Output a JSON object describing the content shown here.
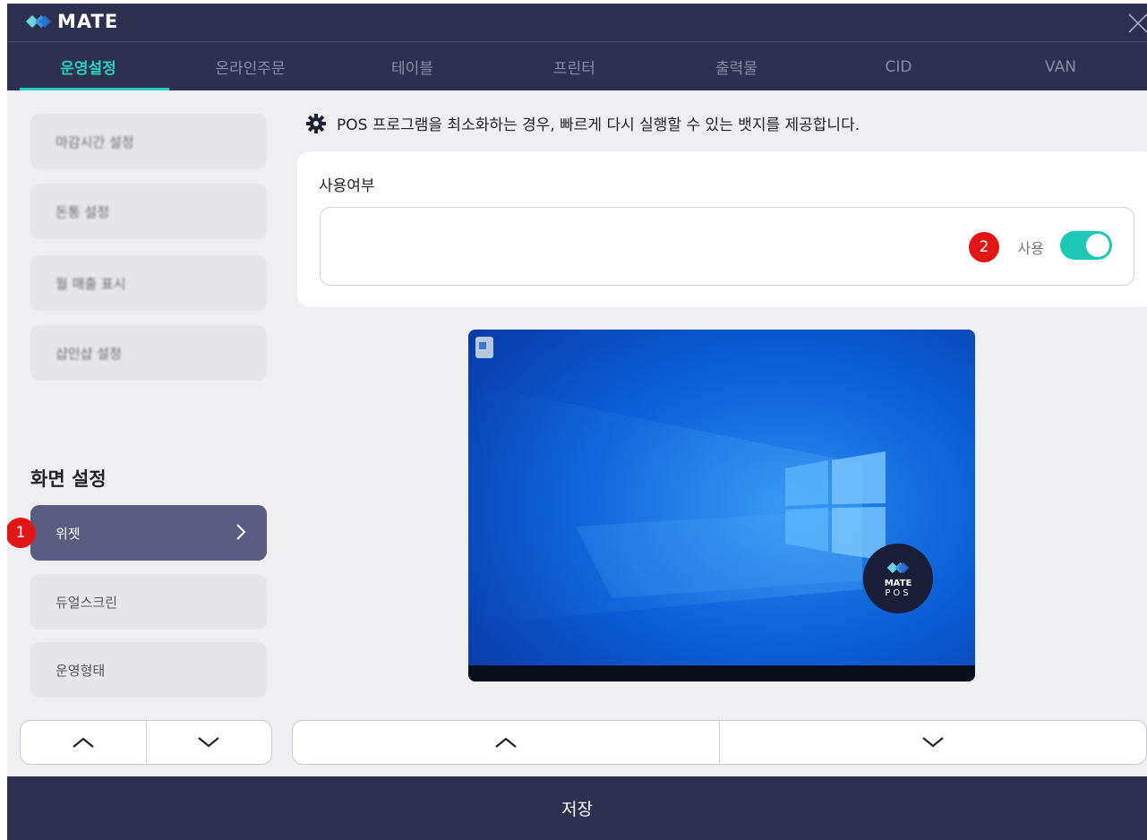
{
  "app": {
    "logo_text": "MATE"
  },
  "tabs": [
    {
      "label": "운영설정",
      "active": true
    },
    {
      "label": "온라인주문"
    },
    {
      "label": "테이블"
    },
    {
      "label": "프린터"
    },
    {
      "label": "출력물"
    },
    {
      "label": "CID"
    },
    {
      "label": "VAN"
    }
  ],
  "sidebar": {
    "blurred_items": [
      "마감시간 설정",
      "돈통 설정",
      "월 매출 표시",
      "샵인샵 설정"
    ],
    "section_title": "화면 설정",
    "items": [
      "위젯",
      "듀얼스크린",
      "운영형태"
    ]
  },
  "badges": {
    "one": "1",
    "two": "2"
  },
  "main": {
    "description": "POS 프로그램을 최소화하는 경우, 빠르게 다시 실행할 수 있는 뱃지를 제공합니다.",
    "card_label": "사용여부",
    "toggle_label": "사용",
    "toggle_on": true,
    "preview_badge_line1": "MATE",
    "preview_badge_line2": "POS"
  },
  "footer": {
    "save_label": "저장"
  },
  "colors": {
    "navy": "#2e3050",
    "accent": "#26d0bf",
    "toggle": "#1dc8b6",
    "active_item": "#5a5c82",
    "badge_red": "#e11717"
  },
  "icons": [
    "mate-logo-icon",
    "close-icon",
    "gear-icon",
    "chevron-right-icon",
    "chevron-up-icon",
    "chevron-down-icon"
  ]
}
